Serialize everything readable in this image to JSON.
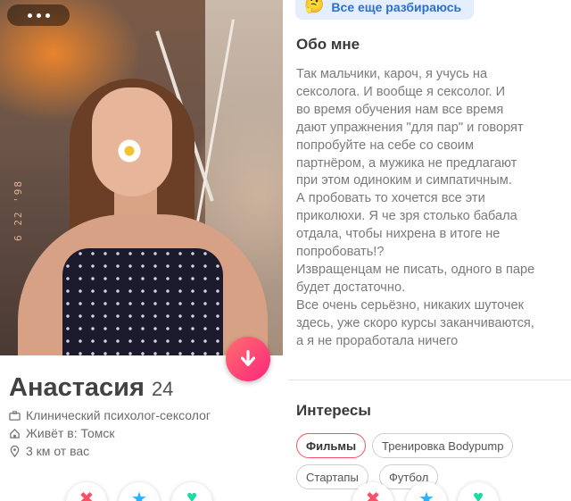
{
  "left_panel": {
    "photo_stamp": "6 22 '98",
    "name": "Анастасия",
    "age": "24",
    "info": [
      {
        "icon": "briefcase-icon",
        "text": "Клинический психолог-сексолог"
      },
      {
        "icon": "home-icon",
        "text": "Живёт в: Томск"
      },
      {
        "icon": "location-pin-icon",
        "text": "3 км от вас"
      }
    ],
    "bottom_actions": [
      {
        "icon": "nope-icon",
        "glyph": "✖",
        "color": "#fd5068"
      },
      {
        "icon": "super-like-icon",
        "glyph": "★",
        "color": "#2db1ff"
      },
      {
        "icon": "like-icon",
        "glyph": "♥",
        "color": "#1fd9a1"
      }
    ]
  },
  "right_panel": {
    "relationship_badge": "Все еще разбираюсь",
    "about_title": "Обо мне",
    "about_text": "Так мальчики, кароч, я учусь на\nсексолога. И вообще я сексолог. И\nво время обучения нам все время\nдают упражнения \"для пар\" и говорят\nпопробуйте на себе со своим\nпартнёром, а мужика не предлагают\nпри этом одиноким и симпатичным.\nА пробовать то хочется все эти\nприколюхи. Я че зря столько бабала\nотдала, чтобы нихрена в итоге не\nпопробовать!?\nИзвращенцам не писать, одного в паре\nбудет достаточно.\nВсе очень серьёзно, никаких шуточек\nздесь, уже скоро курсы заканчиваются,\nа я не проработала ничего",
    "interests_title": "Интересы",
    "interests": [
      "Фильмы",
      "Тренировка Bodypump",
      "Стартапы",
      "Футбол"
    ],
    "bottom_actions": [
      {
        "icon": "nope-icon",
        "glyph": "✖",
        "color": "#fd5068"
      },
      {
        "icon": "super-like-icon",
        "glyph": "★",
        "color": "#2db1ff"
      },
      {
        "icon": "like-icon",
        "glyph": "♥",
        "color": "#1fd9a1"
      }
    ]
  },
  "colors": {
    "accent": "#fd5068",
    "badge_bg": "#e3efff",
    "badge_text": "#2d6fc9"
  }
}
